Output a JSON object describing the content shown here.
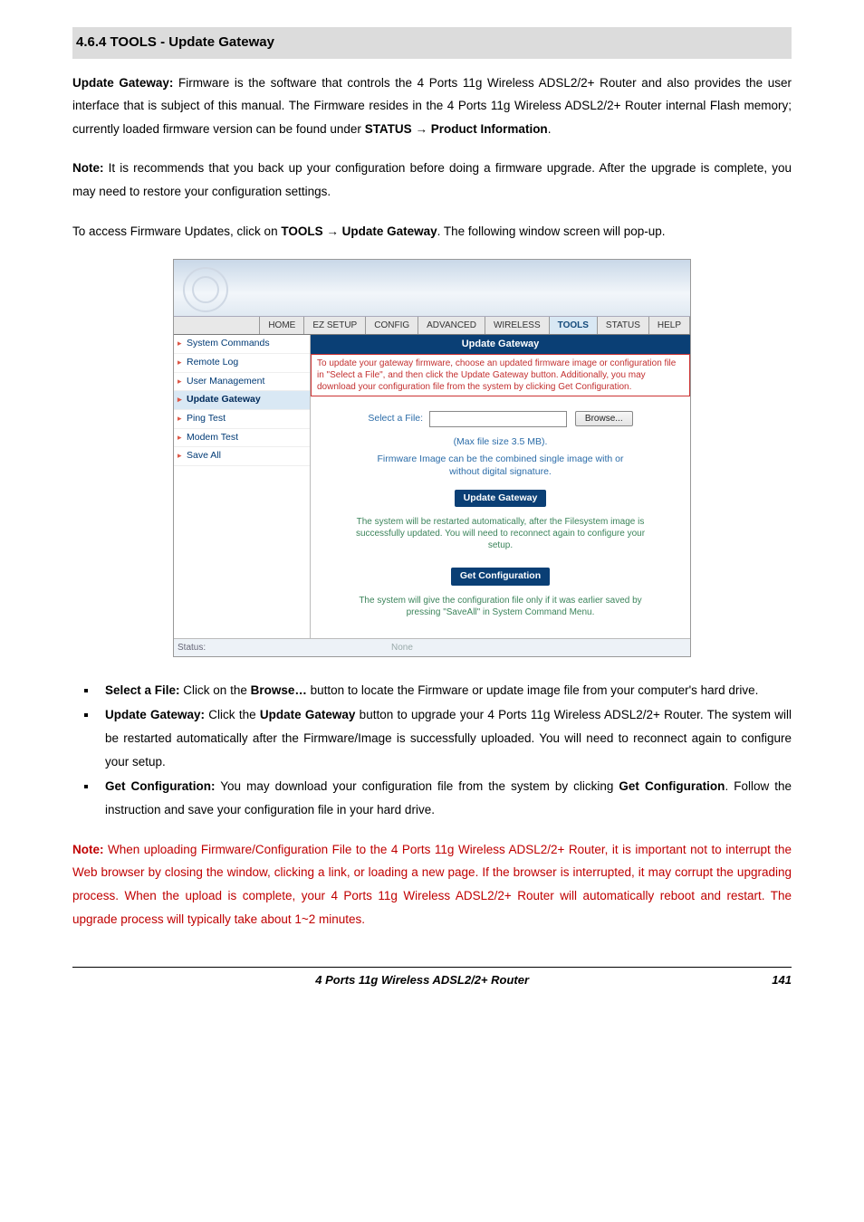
{
  "section_title": "4.6.4 TOOLS - Update Gateway",
  "p1": {
    "lead": "Update Gateway:",
    "body1": " Firmware is the software that controls the 4 Ports 11g Wireless ADSL2/2+ Router and also provides the user interface that is subject of this manual. The Firmware resides in the 4 Ports 11g Wireless ADSL2/2+ Router internal Flash memory; currently loaded firmware version can be found under ",
    "bold2": "STATUS ",
    "arrow": "→",
    "bold3": " Product Information",
    "end": "."
  },
  "p2": {
    "lead": "Note:",
    "body": " It is recommends that you back up your configuration before doing a firmware upgrade. After the upgrade is complete, you may need to restore your configuration settings."
  },
  "p3": {
    "pre": "To access Firmware Updates, click on ",
    "b1": "TOOLS ",
    "arrow": "→",
    "b2": " Update Gateway",
    "post": ". The following window screen will pop-up."
  },
  "shot": {
    "tabs": [
      "HOME",
      "EZ SETUP",
      "CONFIG",
      "ADVANCED",
      "WIRELESS",
      "TOOLS",
      "STATUS",
      "HELP"
    ],
    "active_tab_index": 5,
    "sidenav": [
      "System Commands",
      "Remote Log",
      "User Management",
      "Update Gateway",
      "Ping Test",
      "Modem Test",
      "Save All"
    ],
    "active_side_index": 3,
    "titlebar": "Update Gateway",
    "redtext": "To update your gateway firmware, choose an updated firmware image or configuration file in \"Select a File\", and then click the Update Gateway button. Additionally, you may download your configuration file from the system by clicking Get Configuration.",
    "file_label": "Select a File:",
    "browse_label": "Browse...",
    "info1": "(Max file size 3.5 MB).",
    "info2": "Firmware Image can be the combined single image with or without digital signature.",
    "btn1": "Update Gateway",
    "green1": "The system will be restarted automatically, after the Filesystem image is successfully updated. You will need to reconnect again to configure your setup.",
    "btn2": "Get Configuration",
    "green2": "The system will give the configuration file only if it was earlier saved by pressing \"SaveAll\" in System Command Menu.",
    "status_label": "Status:",
    "status_value": "None"
  },
  "bullets": [
    {
      "lead": "Select a File:",
      "mid1": " Click on the ",
      "bold2": "Browse…",
      "mid2": " button to locate the Firmware or update image file from your computer's hard drive."
    },
    {
      "lead": "Update Gateway:",
      "mid1": " Click the ",
      "bold2": "Update Gateway",
      "mid2": " button to upgrade your 4 Ports 11g Wireless ADSL2/2+ Router. The system will be restarted automatically after the Firmware/Image is successfully uploaded. You will need to reconnect again to configure your setup."
    },
    {
      "lead": "Get Configuration:",
      "mid1": " You may download your configuration file from the system by clicking ",
      "bold2": "Get Configuration",
      "mid2": ". Follow the instruction and save your configuration file in your hard drive."
    }
  ],
  "note_red": {
    "lead": "Note:",
    "body": " When uploading Firmware/Configuration File to the 4 Ports 11g Wireless ADSL2/2+ Router, it is important not to interrupt the Web browser by closing the window, clicking a link, or loading a new page. If the browser is interrupted, it may corrupt the upgrading process. When the upload is complete, your 4 Ports 11g Wireless ADSL2/2+ Router will automatically reboot and restart. The upgrade process will typically take about 1~2 minutes."
  },
  "footer": {
    "left": "4 Ports 11g Wireless ADSL2/2+ Router",
    "right": "141"
  }
}
